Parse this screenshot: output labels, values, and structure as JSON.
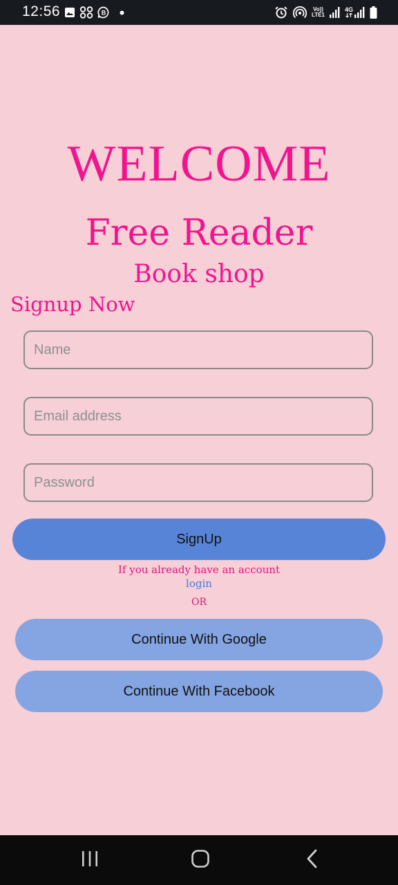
{
  "status_bar": {
    "time": "12:56",
    "left_icons": [
      "image-icon",
      "apps-grid-icon",
      "b-chat-icon",
      "dot-icon"
    ],
    "right_icons": [
      "alarm-icon",
      "hotspot-icon",
      "volte-lte-icon",
      "signal-icon",
      "signal-4g-icon",
      "battery-icon"
    ],
    "volte_top": "Vo))",
    "volte_bottom": "LTE1",
    "network_label": "4G"
  },
  "header": {
    "welcome": "WELCOME",
    "app_name": "Free Reader",
    "app_subtitle": "Book shop"
  },
  "form": {
    "heading": "Signup Now",
    "name_placeholder": "Name",
    "email_placeholder": "Email address",
    "password_placeholder": "Password",
    "signup_label": "SignUp"
  },
  "login_prompt": {
    "text": "If you already have an account",
    "link": "login"
  },
  "divider": "OR",
  "social": {
    "google_label": "Continue With Google",
    "facebook_label": "Continue With Facebook"
  },
  "nav_bar": {
    "icons": [
      "recent-apps-icon",
      "home-icon",
      "back-icon"
    ]
  },
  "colors": {
    "background": "#f6cfd7",
    "accent_pink": "#f0158e",
    "signup_button": "#5884d8",
    "social_button": "#84a5e2",
    "link_blue": "#3a7be0"
  }
}
